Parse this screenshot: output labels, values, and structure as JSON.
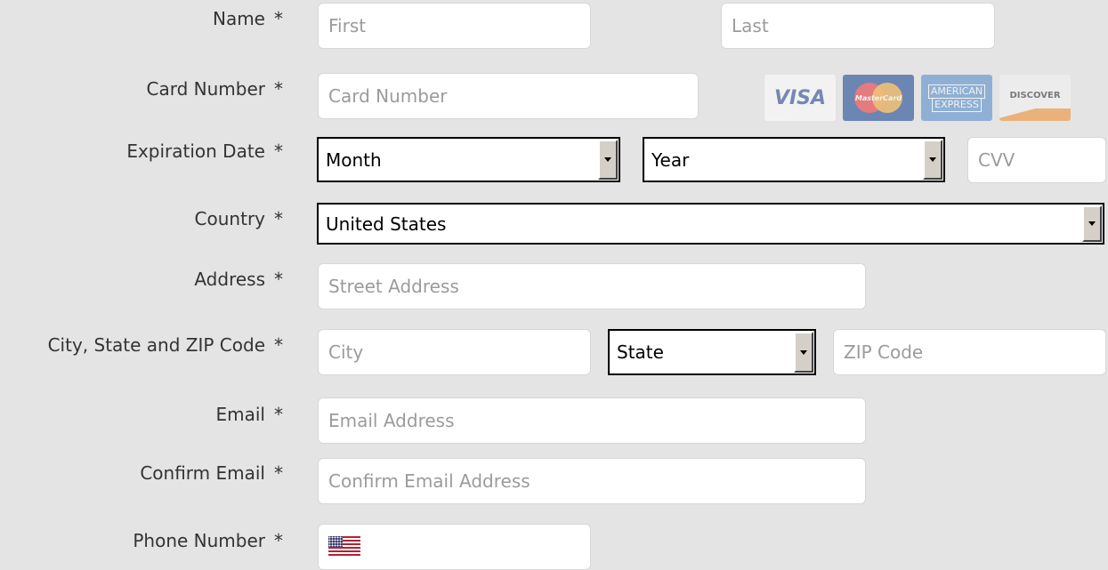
{
  "required_marker": "*",
  "name": {
    "label": "Name",
    "first_placeholder": "First",
    "last_placeholder": "Last"
  },
  "card_number": {
    "label": "Card Number",
    "placeholder": "Card Number",
    "brands": {
      "visa": "VISA",
      "mastercard": "MasterCard",
      "amex_line1": "AMERICAN",
      "amex_line2": "EXPRESS",
      "discover": "DISCOVER"
    }
  },
  "expiration": {
    "label": "Expiration Date",
    "month_value": "Month",
    "year_value": "Year",
    "cvv_placeholder": "CVV"
  },
  "country": {
    "label": "Country",
    "value": "United States"
  },
  "address": {
    "label": "Address",
    "placeholder": "Street Address"
  },
  "city_state_zip": {
    "label": "City, State and ZIP Code",
    "city_placeholder": "City",
    "state_value": "State",
    "zip_placeholder": "ZIP Code"
  },
  "email": {
    "label": "Email",
    "placeholder": "Email Address"
  },
  "confirm_email": {
    "label": "Confirm Email",
    "placeholder": "Confirm Email Address"
  },
  "phone": {
    "label": "Phone Number",
    "flag_icon": "us-flag-icon"
  },
  "colors": {
    "background": "#e4e4e4",
    "label_text": "#333333",
    "placeholder_text": "#9b9b9b",
    "field_border": "#d7d7d7"
  }
}
